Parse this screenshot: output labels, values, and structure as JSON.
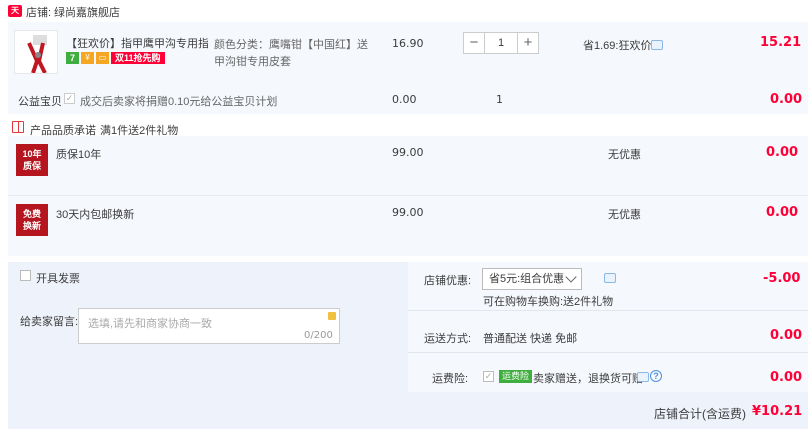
{
  "shop": {
    "label": "店铺:",
    "name": "绿尚嘉旗舰店",
    "icon_text": "天猫"
  },
  "item": {
    "title": "【狂欢价】指甲鹰甲沟专用指甲钳",
    "badges": {
      "seven": "7",
      "sale": "双11抢先购"
    },
    "sku": "颜色分类：鹰嘴钳【中国红】送甲沟钳专用皮套",
    "unit_price": "16.90",
    "qty": "1",
    "qty_minus": "−",
    "qty_plus": "+",
    "discount": "省1.69:狂欢价",
    "total": "15.21"
  },
  "charity": {
    "label": "公益宝贝",
    "check": "✓",
    "text": "成交后卖家将捐赠0.10元给公益宝贝计划",
    "price": "0.00",
    "qty": "1",
    "total": "0.00"
  },
  "promise": {
    "title": "产品品质承诺",
    "subtitle": "满1件送2件礼物"
  },
  "services": [
    {
      "img_text_1": "10年",
      "img_text_2": "质保",
      "name": "质保10年",
      "price": "99.00",
      "discount": "无优惠",
      "total": "0.00"
    },
    {
      "img_text_1": "免费",
      "img_text_2": "换新",
      "name": "30天内包邮换新",
      "price": "99.00",
      "discount": "无优惠",
      "total": "0.00"
    }
  ],
  "invoice": {
    "label": "开具发票"
  },
  "message": {
    "label": "给卖家留言:",
    "placeholder": "选填,请先和商家协商一致",
    "count": "0/200"
  },
  "shop_discount": {
    "label": "店铺优惠:",
    "selected": "省5元:组合优惠",
    "hint": "可在购物车换购:送2件礼物",
    "total": "-5.00"
  },
  "shipping": {
    "label": "运送方式:",
    "value": "普通配送 快递 免邮",
    "total": "0.00"
  },
  "insurance": {
    "label": "运费险:",
    "check": "✓",
    "badge": "运费险",
    "text": "卖家赠送，退换货可赔",
    "help": "?",
    "total": "0.00"
  },
  "summary": {
    "label": "店铺合计(含运费)",
    "value": "¥10.21"
  },
  "colors": {
    "accent": "#ff0036",
    "panel": "#f5f8fd",
    "bottom": "#eef2fb"
  }
}
